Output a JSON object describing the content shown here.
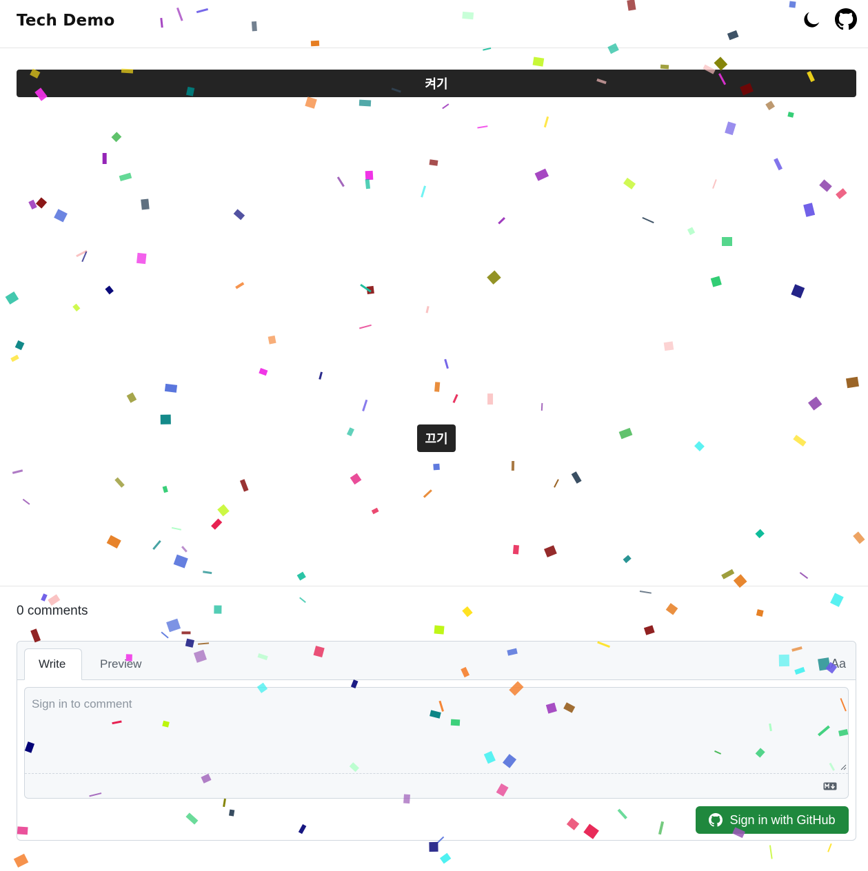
{
  "header": {
    "title": "Tech Demo",
    "theme_icon": "moon-icon",
    "repo_icon": "github-icon"
  },
  "confetti_demo": {
    "on_label": "켜기",
    "off_label": "끄기"
  },
  "comments": {
    "count_label": "0 comments",
    "tabs": [
      "Write",
      "Preview"
    ],
    "active_tab": "Write",
    "font_toggle_label": "Aa",
    "placeholder": "Sign in to comment",
    "markdown_icon": "markdown-icon",
    "signin_label": "Sign in with GitHub",
    "signin_color": "#1f883d"
  },
  "colors": {
    "button_dark": "#242424",
    "border": "#d0d7de"
  }
}
